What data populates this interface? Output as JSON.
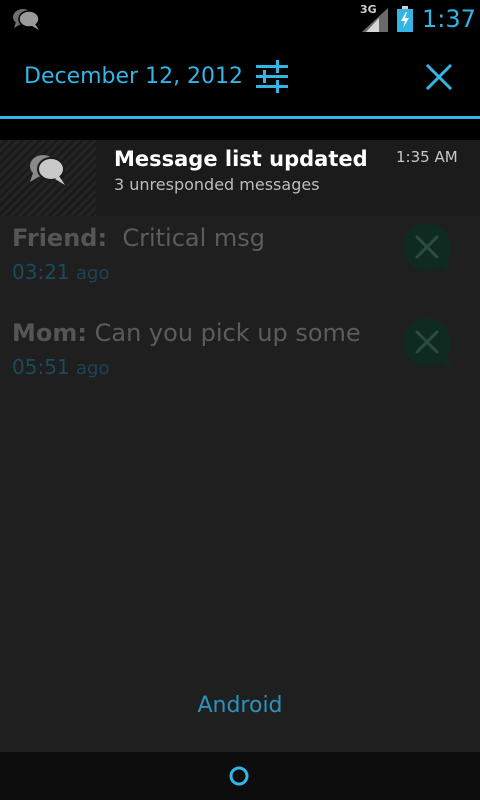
{
  "status_bar": {
    "network_label": "3G",
    "time": "1:37",
    "icons": [
      "chat-icon",
      "signal-icon",
      "battery-charging-icon"
    ]
  },
  "notification_header": {
    "date": "December 12, 2012",
    "icons": [
      "settings-sliders-icon",
      "clear-all-icon"
    ]
  },
  "notification": {
    "title": "Message list updated",
    "time": "1:35 AM",
    "text": "3 unresponded messages",
    "icon": "chat-bubbles-icon"
  },
  "messages": [
    {
      "sender": "Friend:",
      "body": "Critical msg",
      "elapsed": "03:21",
      "ago": "ago"
    },
    {
      "sender": "Mom:",
      "body": "Can you pick up some",
      "elapsed": "05:51",
      "ago": "ago"
    }
  ],
  "footer_link": "Android",
  "colors": {
    "accent": "#33b5e5",
    "background": "#000000",
    "content_dim": "#1f1f1f"
  }
}
